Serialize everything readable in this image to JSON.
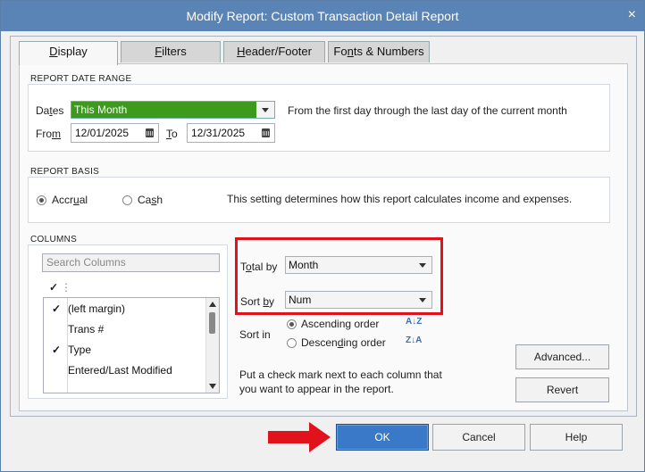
{
  "window": {
    "title": "Modify Report: Custom Transaction Detail Report",
    "close": "×"
  },
  "tabs": [
    {
      "label": "Display",
      "accel": "D",
      "rest": "isplay",
      "active": true
    },
    {
      "label": "Filters",
      "accel": "F",
      "rest": "ilters",
      "active": false
    },
    {
      "label": "Header/Footer",
      "accel": "H",
      "rest": "eader/Footer",
      "active": false
    },
    {
      "label": "Fonts & Numbers",
      "pre": "Fo",
      "accel": "n",
      "rest": "ts & Numbers",
      "active": false
    }
  ],
  "date_range": {
    "section": "REPORT DATE RANGE",
    "dates_label_pre": "Da",
    "dates_label_accel": "t",
    "dates_label_post": "es",
    "dates_value": "This Month",
    "description": "From the first day through the last day of the current month",
    "from_label_pre": "Fro",
    "from_label_accel": "m",
    "from_value": "12/01/2025",
    "to_label_accel": "T",
    "to_label_post": "o",
    "to_value": "12/31/2025"
  },
  "basis": {
    "section": "REPORT BASIS",
    "accrual_pre": "Accr",
    "accrual_accel": "u",
    "accrual_post": "al",
    "cash_pre": "Ca",
    "cash_accel": "s",
    "cash_post": "h",
    "selected": "Accrual",
    "description": "This setting determines how this report calculates income and expenses."
  },
  "columns": {
    "section": "COLUMNS",
    "search_placeholder": "Search Columns",
    "header_check": "✓",
    "header_sep": "⋮",
    "items": [
      {
        "checked": "✓",
        "label": "(left margin)"
      },
      {
        "checked": "",
        "label": "Trans #"
      },
      {
        "checked": "✓",
        "label": "Type"
      },
      {
        "checked": "",
        "label": "Entered/Last Modified"
      }
    ],
    "hint": "Put a check mark next to each column that you want to appear in the report."
  },
  "total_by": {
    "pre": "T",
    "accel": "o",
    "post": "tal by",
    "value": "Month"
  },
  "sort_by": {
    "pre": "Sort ",
    "accel": "b",
    "post": "y",
    "value": "Num"
  },
  "sort_in": {
    "label": "Sort in",
    "ascending": "Ascending order",
    "descending_pre": "Descen",
    "descending_accel": "d",
    "descending_post": "ing order",
    "selected": "Ascending order",
    "asc_icon": "A↓Z",
    "desc_icon": "Z↓A"
  },
  "buttons": {
    "advanced": "Advanced...",
    "revert": "Revert",
    "ok": "OK",
    "cancel": "Cancel",
    "help": "Help"
  },
  "colors": {
    "title_bar": "#5a84b5",
    "highlight_green": "#3c9a1c",
    "annotation_red": "#e0131c",
    "ok_blue": "#3a78c8"
  }
}
